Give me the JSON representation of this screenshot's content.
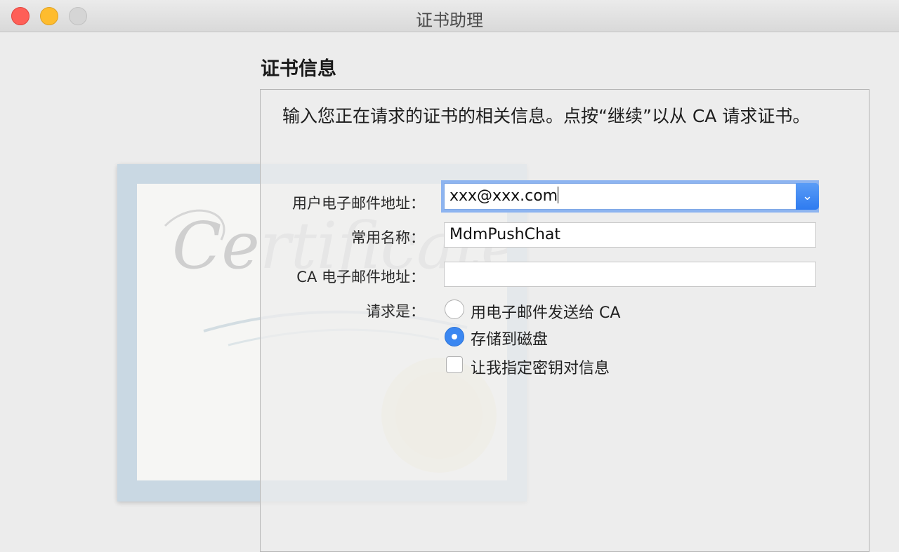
{
  "window": {
    "title": "证书助理"
  },
  "certificate_art": {
    "watermark_text": "Certificate",
    "frame_color": "#c9d8e3"
  },
  "section": {
    "title": "证书信息",
    "instructions": "输入您正在请求的证书的相关信息。点按“继续”以从 CA 请求证书。"
  },
  "form": {
    "user_email": {
      "label": "用户电子邮件地址：",
      "value": "xxx@xxx.com"
    },
    "common_name": {
      "label": "常用名称：",
      "value": "MdmPushChat"
    },
    "ca_email": {
      "label": "CA 电子邮件地址：",
      "value": ""
    },
    "request_is": {
      "label": "请求是：",
      "options": [
        {
          "label": "用电子邮件发送给 CA",
          "selected": false
        },
        {
          "label": "存储到磁盘",
          "selected": true
        }
      ]
    },
    "specify_keypair": {
      "label": "让我指定密钥对信息",
      "checked": false
    }
  },
  "colors": {
    "accent": "#3b87f1",
    "close": "#fe5f57",
    "minimize": "#febc2e",
    "focus_ring": "#8db4f0"
  },
  "icons": {
    "dropdown": "chevron-down-icon"
  }
}
